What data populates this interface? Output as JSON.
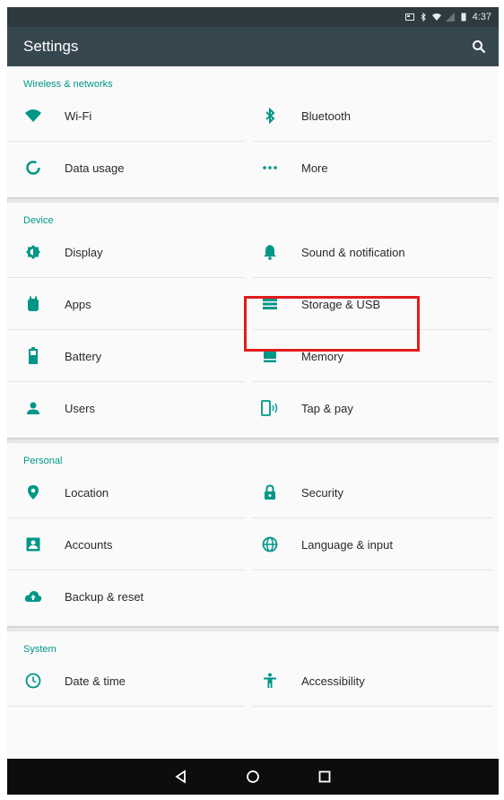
{
  "statusbar": {
    "time": "4:37"
  },
  "toolbar": {
    "title": "Settings"
  },
  "sections": [
    {
      "header": "Wireless & networks",
      "items": [
        {
          "label": "Wi-Fi",
          "icon": "wifi-icon"
        },
        {
          "label": "Bluetooth",
          "icon": "bluetooth-icon"
        },
        {
          "label": "Data usage",
          "icon": "data-usage-icon"
        },
        {
          "label": "More",
          "icon": "more-icon"
        }
      ]
    },
    {
      "header": "Device",
      "items": [
        {
          "label": "Display",
          "icon": "display-icon"
        },
        {
          "label": "Sound & notification",
          "icon": "bell-icon"
        },
        {
          "label": "Apps",
          "icon": "apps-icon"
        },
        {
          "label": "Storage & USB",
          "icon": "storage-icon"
        },
        {
          "label": "Battery",
          "icon": "battery-icon"
        },
        {
          "label": "Memory",
          "icon": "memory-icon"
        },
        {
          "label": "Users",
          "icon": "user-icon"
        },
        {
          "label": "Tap & pay",
          "icon": "tap-pay-icon"
        }
      ]
    },
    {
      "header": "Personal",
      "items": [
        {
          "label": "Location",
          "icon": "location-icon"
        },
        {
          "label": "Security",
          "icon": "lock-icon"
        },
        {
          "label": "Accounts",
          "icon": "accounts-icon"
        },
        {
          "label": "Language & input",
          "icon": "globe-icon"
        },
        {
          "label": "Backup & reset",
          "icon": "cloud-icon"
        }
      ]
    },
    {
      "header": "System",
      "items": [
        {
          "label": "Date & time",
          "icon": "clock-icon"
        },
        {
          "label": "Accessibility",
          "icon": "accessibility-icon"
        }
      ]
    }
  ],
  "colors": {
    "accent": "#009688",
    "toolbar": "#37474f",
    "statusbar": "#2e3a3f",
    "highlight": "#e31b1b"
  }
}
